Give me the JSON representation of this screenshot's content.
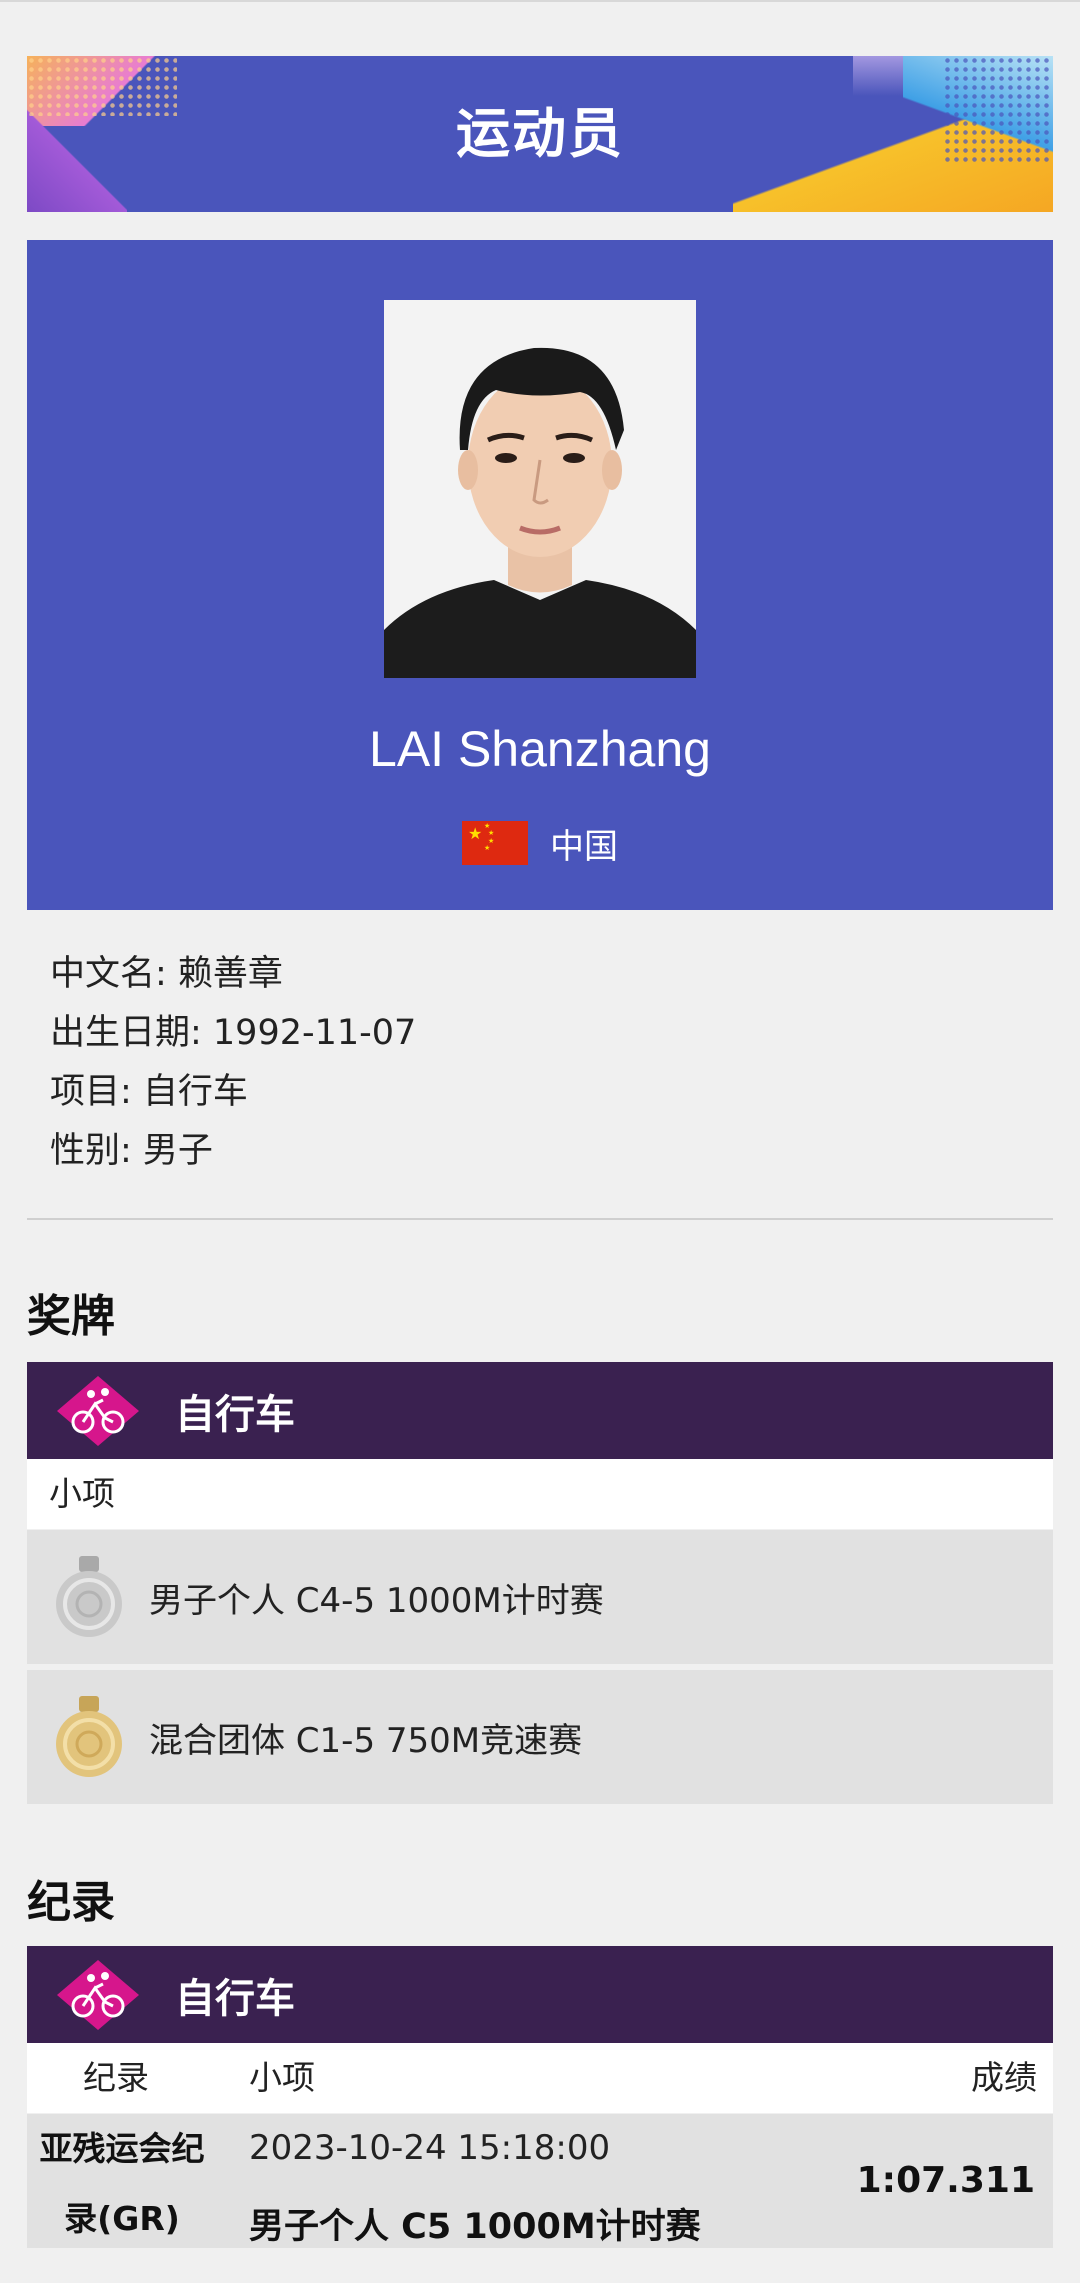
{
  "header": {
    "title": "运动员"
  },
  "athlete": {
    "name": "LAI Shanzhang",
    "country": "中国",
    "flag_color": "#de2910",
    "info": [
      "中文名: 赖善章",
      "出生日期: 1992-11-07",
      "项目: 自行车",
      "性别: 男子"
    ]
  },
  "medals": {
    "section_title": "奖牌",
    "sport": "自行车",
    "sport_icon": "cycling-icon",
    "column_label": "小项",
    "items": [
      {
        "medal": "silver",
        "event": "男子个人 C4-5 1000M计时赛"
      },
      {
        "medal": "gold",
        "event": "混合团体 C1-5 750M竞速赛"
      }
    ]
  },
  "records": {
    "section_title": "纪录",
    "sport": "自行车",
    "sport_icon": "cycling-icon",
    "columns": {
      "record": "纪录",
      "event": "小项",
      "result": "成绩"
    },
    "rows": [
      {
        "type_line1": "亚残运会纪",
        "type_line2": "录(GR)",
        "datetime": "2023-10-24 15:18:00",
        "event": "男子个人 C5 1000M计时赛",
        "result": "1:07.311"
      }
    ]
  },
  "colors": {
    "brand_blue": "#4a55bb",
    "sport_bar": "#3a2150",
    "sport_icon_bg": "#d6168c"
  }
}
